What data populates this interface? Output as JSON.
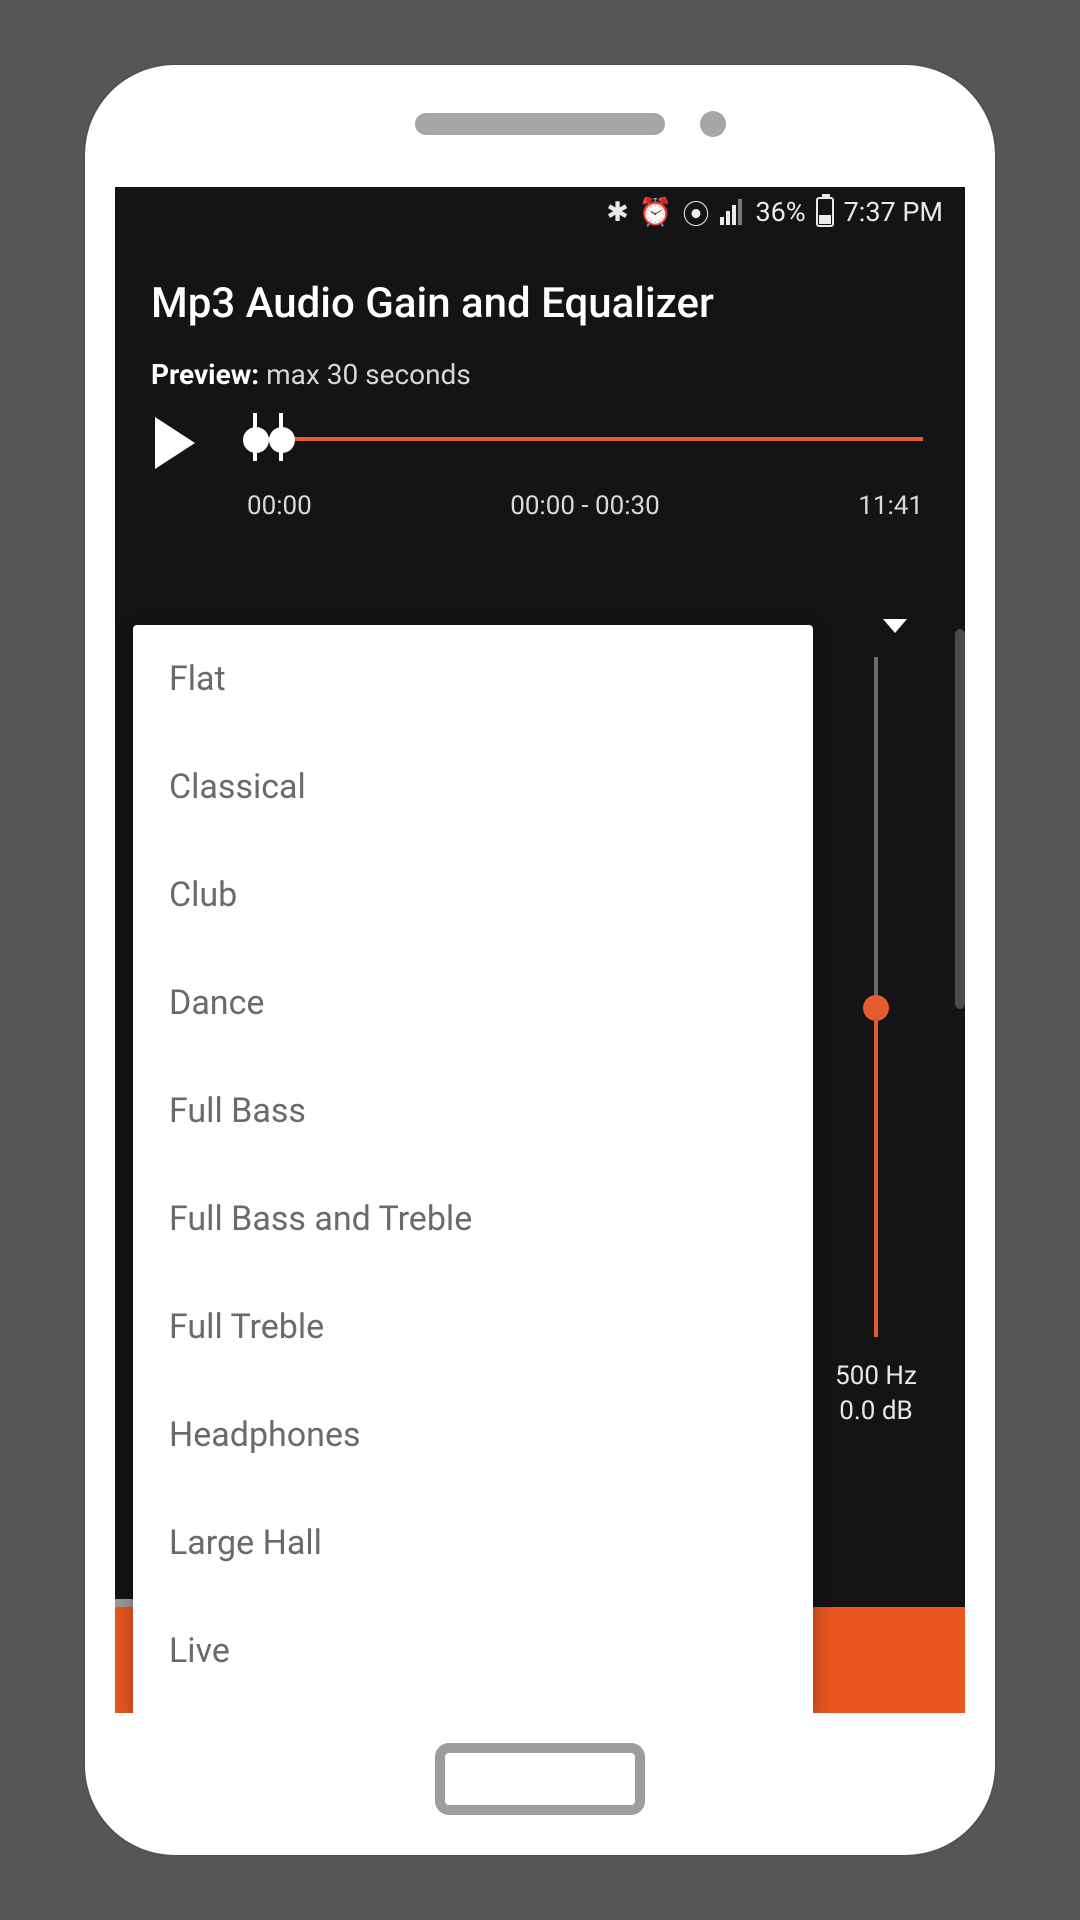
{
  "statusbar": {
    "battery_pct": "36%",
    "time": "7:37 PM"
  },
  "app": {
    "title": "Mp3 Audio Gain and Equalizer",
    "preview_label": "Preview:",
    "preview_value": "max 30 seconds",
    "time_start": "00:00",
    "time_range": "00:00 - 00:30",
    "time_total": "11:41"
  },
  "eq": {
    "freq": "500 Hz",
    "gain": "0.0 dB"
  },
  "presets": [
    "Flat",
    "Classical",
    "Club",
    "Dance",
    "Full Bass",
    "Full Bass and Treble",
    "Full Treble",
    "Headphones",
    "Large Hall",
    "Live"
  ]
}
